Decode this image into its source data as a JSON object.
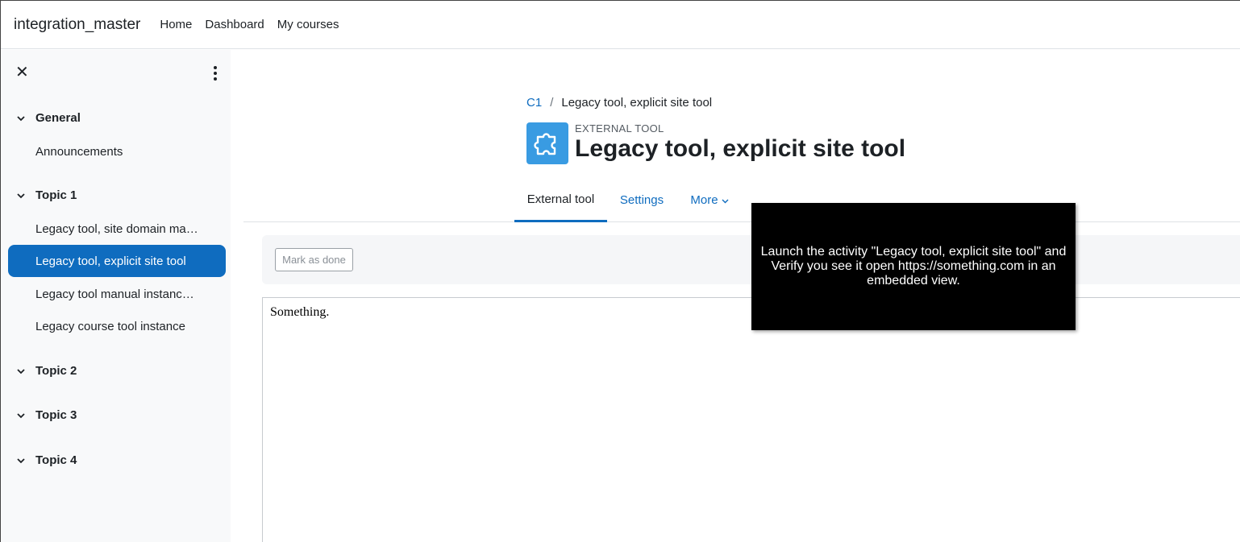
{
  "navbar": {
    "brand": "integration_master",
    "links": [
      "Home",
      "Dashboard",
      "My courses"
    ]
  },
  "drawer": {
    "sections": [
      {
        "title": "General",
        "items": [
          "Announcements"
        ]
      },
      {
        "title": "Topic 1",
        "items": [
          "Legacy tool, site domain ma…",
          "Legacy tool, explicit site tool",
          "Legacy tool manual instanc…",
          "Legacy course tool instance"
        ]
      },
      {
        "title": "Topic 2",
        "items": []
      },
      {
        "title": "Topic 3",
        "items": []
      },
      {
        "title": "Topic 4",
        "items": []
      }
    ],
    "active_item": "Legacy tool, explicit site tool"
  },
  "breadcrumb": {
    "course": "C1",
    "separator": "/",
    "current": "Legacy tool, explicit site tool"
  },
  "activity": {
    "type_label": "EXTERNAL TOOL",
    "title": "Legacy tool, explicit site tool",
    "icon": "puzzle-icon"
  },
  "tabs": [
    {
      "label": "External tool",
      "active": true
    },
    {
      "label": "Settings",
      "active": false
    },
    {
      "label": "More",
      "active": false
    }
  ],
  "completion": {
    "button_label": "Mark as done"
  },
  "embed": {
    "content": "Something."
  },
  "tooltip": {
    "text": "Launch the activity \"Legacy tool, explicit site tool\" and Verify you see it open https://something.com in an embedded view."
  },
  "colors": {
    "accent": "#0f6cbf",
    "icon_bg": "#399be2",
    "drawer_bg": "#f8f9fa"
  }
}
